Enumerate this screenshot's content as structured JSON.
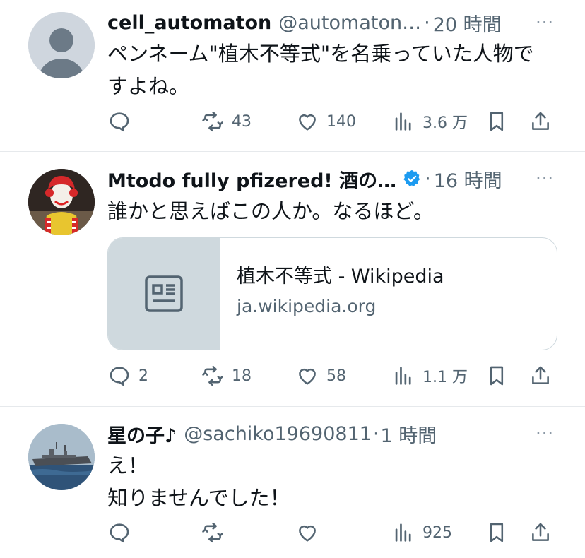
{
  "tweets": [
    {
      "name": "cell_automaton",
      "handle": "@automaton…",
      "time": "20 時間",
      "more": "···",
      "text_lines": [
        "ペンネーム\"植木不等式\"を名乗っていた人物で",
        "すよね。"
      ],
      "actions": {
        "reply": "",
        "retweet": "43",
        "like": "140",
        "views": "3.6 万"
      }
    },
    {
      "name": "Mtodo fully pfizered! 酒の…",
      "handle": "",
      "verified": true,
      "time": "16 時間",
      "more": "···",
      "text_lines": [
        "誰かと思えばこの人か。なるほど。"
      ],
      "card": {
        "title": "植木不等式 - Wikipedia",
        "domain": "ja.wikipedia.org",
        "thumb_icon": "article-icon"
      },
      "actions": {
        "reply": "2",
        "retweet": "18",
        "like": "58",
        "views": "1.1 万"
      }
    },
    {
      "name": "星の子♪",
      "handle": "@sachiko19690811",
      "time": "1 時間",
      "more": "···",
      "text_lines": [
        "え！",
        "知りませんでした！"
      ],
      "actions": {
        "reply": "",
        "retweet": "",
        "like": "",
        "views": "925"
      }
    }
  ],
  "colors": {
    "muted": "#536471",
    "verified": "#1d9bf0",
    "border": "#e6e9ec",
    "card_thumb": "#cfd9de"
  },
  "icons": [
    "reply-icon",
    "retweet-icon",
    "like-icon",
    "views-icon",
    "bookmark-icon",
    "share-icon",
    "more-icon",
    "verified-icon"
  ]
}
